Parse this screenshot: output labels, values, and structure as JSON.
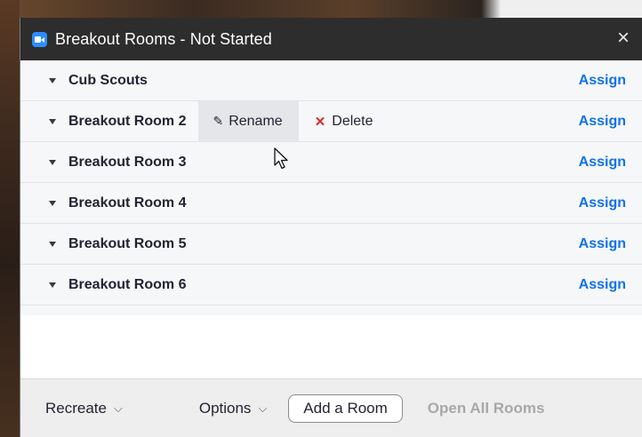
{
  "window": {
    "title": "Breakout Rooms - Not Started",
    "close_symbol": "×"
  },
  "rooms": [
    {
      "name": "Cub Scouts",
      "assign": "Assign"
    },
    {
      "name": "Breakout Room 2",
      "assign": "Assign"
    },
    {
      "name": "Breakout Room 3",
      "assign": "Assign"
    },
    {
      "name": "Breakout Room 4",
      "assign": "Assign"
    },
    {
      "name": "Breakout Room 5",
      "assign": "Assign"
    },
    {
      "name": "Breakout Room 6",
      "assign": "Assign"
    }
  ],
  "hover_actions": {
    "rename": "Rename",
    "delete": "Delete"
  },
  "footer": {
    "recreate": "Recreate",
    "options": "Options",
    "add_room": "Add a Room",
    "open_all": "Open All Rooms"
  },
  "colors": {
    "accent": "#0e72ed",
    "titlebar": "#2d2d2d",
    "delete_x": "#e02828"
  },
  "icons": [
    "zoom-app-icon",
    "close-icon",
    "caret-down-icon",
    "pencil-icon",
    "x-icon",
    "chevron-down-icon",
    "mouse-cursor-icon"
  ]
}
